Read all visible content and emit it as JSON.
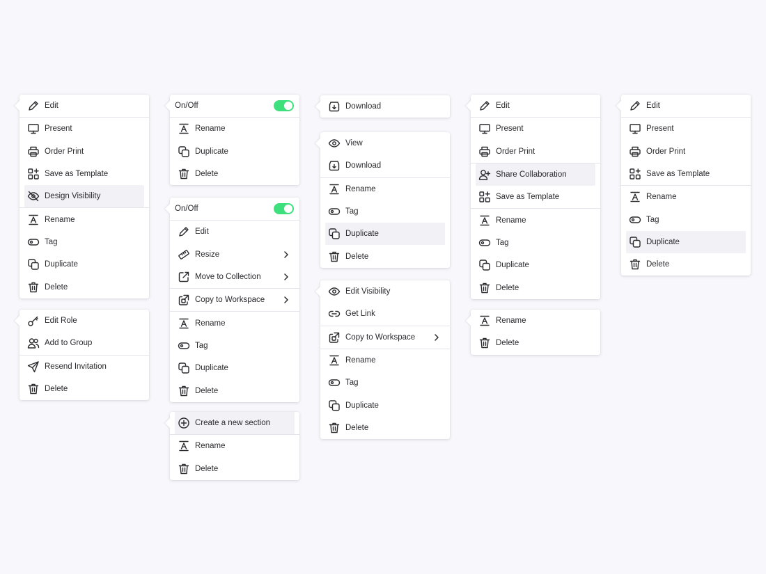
{
  "colors": {
    "background": "#f8f8fc",
    "toggle_on": "#3ee07e",
    "highlight": "#f1f1f6"
  },
  "menus": [
    {
      "id": "m1",
      "items": [
        {
          "t": "item",
          "label": "Edit",
          "icon": "pencil-icon"
        },
        {
          "t": "sep"
        },
        {
          "t": "item",
          "label": "Present",
          "icon": "monitor-icon"
        },
        {
          "t": "item",
          "label": "Order Print",
          "icon": "printer-icon"
        },
        {
          "t": "item",
          "label": "Save as Template",
          "icon": "template-add-icon"
        },
        {
          "t": "item",
          "label": "Design Visibility",
          "icon": "eye-off-icon",
          "hl": true
        },
        {
          "t": "sep"
        },
        {
          "t": "item",
          "label": "Rename",
          "icon": "rename-icon"
        },
        {
          "t": "item",
          "label": "Tag",
          "icon": "tag-icon"
        },
        {
          "t": "item",
          "label": "Duplicate",
          "icon": "duplicate-icon"
        },
        {
          "t": "item",
          "label": "Delete",
          "icon": "trash-icon"
        }
      ]
    },
    {
      "id": "m2",
      "items": [
        {
          "t": "item",
          "label": "Edit Role",
          "icon": "key-icon"
        },
        {
          "t": "item",
          "label": "Add to Group",
          "icon": "users-icon"
        },
        {
          "t": "sep"
        },
        {
          "t": "item",
          "label": "Resend Invitation",
          "icon": "send-icon"
        },
        {
          "t": "item",
          "label": "Delete",
          "icon": "trash-icon"
        }
      ]
    },
    {
      "id": "m3",
      "items": [
        {
          "t": "toggle",
          "label": "On/Off",
          "on": true
        },
        {
          "t": "sep"
        },
        {
          "t": "item",
          "label": "Rename",
          "icon": "rename-icon"
        },
        {
          "t": "item",
          "label": "Duplicate",
          "icon": "duplicate-icon"
        },
        {
          "t": "item",
          "label": "Delete",
          "icon": "trash-icon"
        }
      ]
    },
    {
      "id": "m4",
      "items": [
        {
          "t": "toggle",
          "label": "On/Off",
          "on": true
        },
        {
          "t": "sep"
        },
        {
          "t": "item",
          "label": "Edit",
          "icon": "pencil-icon"
        },
        {
          "t": "item",
          "label": "Resize",
          "icon": "ruler-icon",
          "sub": true
        },
        {
          "t": "item",
          "label": "Move to Collection",
          "icon": "external-link-icon",
          "sub": true
        },
        {
          "t": "sep"
        },
        {
          "t": "item",
          "label": "Copy to Workspace",
          "icon": "copy-workspace-icon",
          "sub": true
        },
        {
          "t": "sep"
        },
        {
          "t": "item",
          "label": "Rename",
          "icon": "rename-icon"
        },
        {
          "t": "item",
          "label": "Tag",
          "icon": "tag-icon"
        },
        {
          "t": "item",
          "label": "Duplicate",
          "icon": "duplicate-icon"
        },
        {
          "t": "item",
          "label": "Delete",
          "icon": "trash-icon"
        }
      ]
    },
    {
      "id": "m5",
      "items": [
        {
          "t": "item",
          "label": "Create a new section",
          "icon": "plus-circle-icon",
          "hl": true
        },
        {
          "t": "sep"
        },
        {
          "t": "item",
          "label": "Rename",
          "icon": "rename-icon"
        },
        {
          "t": "item",
          "label": "Delete",
          "icon": "trash-icon"
        }
      ]
    },
    {
      "id": "m6",
      "items": [
        {
          "t": "item",
          "label": "Download",
          "icon": "download-icon"
        }
      ]
    },
    {
      "id": "m7",
      "items": [
        {
          "t": "item",
          "label": "View",
          "icon": "eye-icon"
        },
        {
          "t": "item",
          "label": "Download",
          "icon": "download-icon"
        },
        {
          "t": "sep"
        },
        {
          "t": "item",
          "label": "Rename",
          "icon": "rename-icon"
        },
        {
          "t": "item",
          "label": "Tag",
          "icon": "tag-icon"
        },
        {
          "t": "item",
          "label": "Duplicate",
          "icon": "duplicate-icon",
          "hl": true
        },
        {
          "t": "item",
          "label": "Delete",
          "icon": "trash-icon"
        }
      ]
    },
    {
      "id": "m8",
      "items": [
        {
          "t": "item",
          "label": "Edit Visibility",
          "icon": "eye-icon"
        },
        {
          "t": "item",
          "label": "Get Link",
          "icon": "link-icon"
        },
        {
          "t": "sep"
        },
        {
          "t": "item",
          "label": "Copy to Workspace",
          "icon": "copy-workspace-icon",
          "sub": true
        },
        {
          "t": "sep"
        },
        {
          "t": "item",
          "label": "Rename",
          "icon": "rename-icon"
        },
        {
          "t": "item",
          "label": "Tag",
          "icon": "tag-icon"
        },
        {
          "t": "item",
          "label": "Duplicate",
          "icon": "duplicate-icon"
        },
        {
          "t": "item",
          "label": "Delete",
          "icon": "trash-icon"
        }
      ]
    },
    {
      "id": "m9",
      "items": [
        {
          "t": "item",
          "label": "Edit",
          "icon": "pencil-icon"
        },
        {
          "t": "sep"
        },
        {
          "t": "item",
          "label": "Present",
          "icon": "monitor-icon"
        },
        {
          "t": "item",
          "label": "Order Print",
          "icon": "printer-icon"
        },
        {
          "t": "sep"
        },
        {
          "t": "item",
          "label": "Share Collaboration",
          "icon": "user-add-icon",
          "hl": true
        },
        {
          "t": "item",
          "label": "Save as Template",
          "icon": "template-add-icon"
        },
        {
          "t": "sep"
        },
        {
          "t": "item",
          "label": "Rename",
          "icon": "rename-icon"
        },
        {
          "t": "item",
          "label": "Tag",
          "icon": "tag-icon"
        },
        {
          "t": "item",
          "label": "Duplicate",
          "icon": "duplicate-icon"
        },
        {
          "t": "item",
          "label": "Delete",
          "icon": "trash-icon"
        }
      ]
    },
    {
      "id": "m10",
      "items": [
        {
          "t": "item",
          "label": "Rename",
          "icon": "rename-icon"
        },
        {
          "t": "item",
          "label": "Delete",
          "icon": "trash-icon"
        }
      ]
    },
    {
      "id": "m11",
      "items": [
        {
          "t": "item",
          "label": "Edit",
          "icon": "pencil-icon"
        },
        {
          "t": "sep"
        },
        {
          "t": "item",
          "label": "Present",
          "icon": "monitor-icon"
        },
        {
          "t": "item",
          "label": "Order Print",
          "icon": "printer-icon"
        },
        {
          "t": "item",
          "label": "Save as Template",
          "icon": "template-add-icon"
        },
        {
          "t": "sep"
        },
        {
          "t": "item",
          "label": "Rename",
          "icon": "rename-icon"
        },
        {
          "t": "item",
          "label": "Tag",
          "icon": "tag-icon"
        },
        {
          "t": "item",
          "label": "Duplicate",
          "icon": "duplicate-icon",
          "hl": true
        },
        {
          "t": "item",
          "label": "Delete",
          "icon": "trash-icon"
        }
      ]
    }
  ]
}
